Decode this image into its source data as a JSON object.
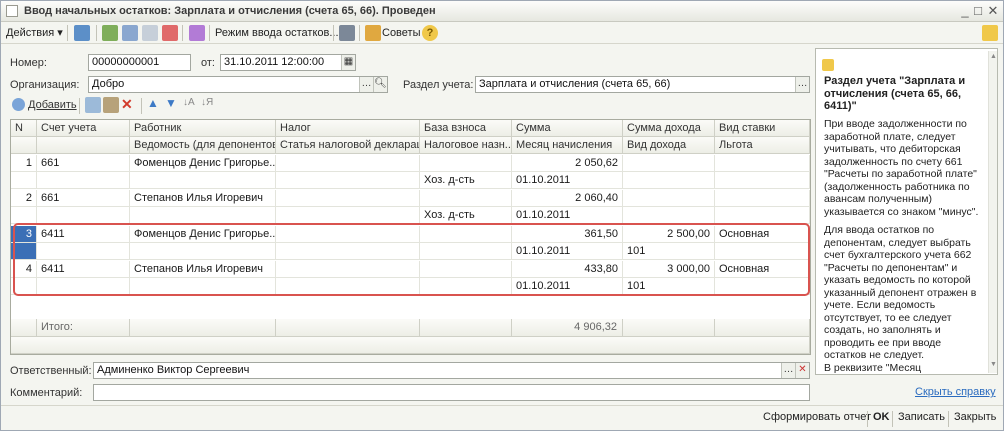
{
  "window": {
    "title": "Ввод начальных остатков: Зарплата и отчисления (счета 65, 66). Проведен"
  },
  "toolbar": {
    "actions_label": "Действия ▾",
    "mode_label": "Режим ввода остатков...",
    "advice_label": "Советы"
  },
  "header": {
    "number_label": "Номер:",
    "number_value": "00000000001",
    "date_label": "от:",
    "date_value": "31.10.2011 12:00:00",
    "org_label": "Организация:",
    "org_value": "Добро",
    "section_label": "Раздел учета:",
    "section_value": "Зарплата и отчисления (счета 65, 66)"
  },
  "table_toolbar": {
    "add_label": "Добавить"
  },
  "table": {
    "headers1": [
      "N",
      "Счет учета",
      "Работник",
      "Налог",
      "База взноса",
      "Сумма",
      "Сумма дохода",
      "Вид ставки"
    ],
    "headers2": [
      "",
      "",
      "Ведомость (для депонентов)",
      "Статья налоговой декларации",
      "Налоговое назн...",
      "Месяц начисления",
      "Вид дохода",
      "Льгота"
    ],
    "rows": [
      {
        "n": "1",
        "account": "661",
        "worker": "Фоменцов Денис Григорье...",
        "sum": "2 050,62",
        "base": "Хоз. д-сть",
        "month": "01.10.2011",
        "income": "",
        "income_type": "",
        "rate": ""
      },
      {
        "n": "2",
        "account": "661",
        "worker": "Степанов Илья Игоревич",
        "sum": "2 060,40",
        "base": "Хоз. д-сть",
        "month": "01.10.2011",
        "income": "",
        "income_type": "",
        "rate": ""
      },
      {
        "n": "3",
        "account": "6411",
        "worker": "Фоменцов Денис Григорье...",
        "sum": "361,50",
        "base": "",
        "month": "01.10.2011",
        "income": "2 500,00",
        "income_type": "101",
        "rate": "Основная"
      },
      {
        "n": "4",
        "account": "6411",
        "worker": "Степанов Илья Игоревич",
        "sum": "433,80",
        "base": "",
        "month": "01.10.2011",
        "income": "3 000,00",
        "income_type": "101",
        "rate": "Основная"
      }
    ],
    "total_label": "Итого:",
    "total_value": "4 906,32"
  },
  "footer": {
    "responsible_label": "Ответственный:",
    "responsible_value": "Админенко Виктор Сергеевич",
    "comment_label": "Комментарий:",
    "comment_value": ""
  },
  "sidebar": {
    "heading": "Раздел учета \"Зарплата и отчисления (счета 65, 66, 6411)\"",
    "p1": "При вводе задолженности по заработной плате, следует учитывать, что дебиторская задолженность по счету 661 \"Расчеты по заработной плате\" (задолженность работника по авансам полученным) указывается со знаком \"минус\".",
    "p2": "Для ввода остатков по депонентам, следует выбрать счет бухгалтерского учета 662 \"Расчеты по депонентам\" и указать ведомость по которой указанный депонент отражен в учете. Если ведомость отсутствует, то ее следует создать, но заполнять и проводить ее при вводе остатков не следует.",
    "p3": "В реквизите \"Месяц начисления\"",
    "hide_link": "Скрыть справку"
  },
  "status": {
    "report_label": "Сформировать отчет",
    "ok_label": "OK",
    "save_label": "Записать",
    "close_label": "Закрыть"
  },
  "colors": {
    "highlight": "#d9534f",
    "selection": "#3b6fb6"
  }
}
